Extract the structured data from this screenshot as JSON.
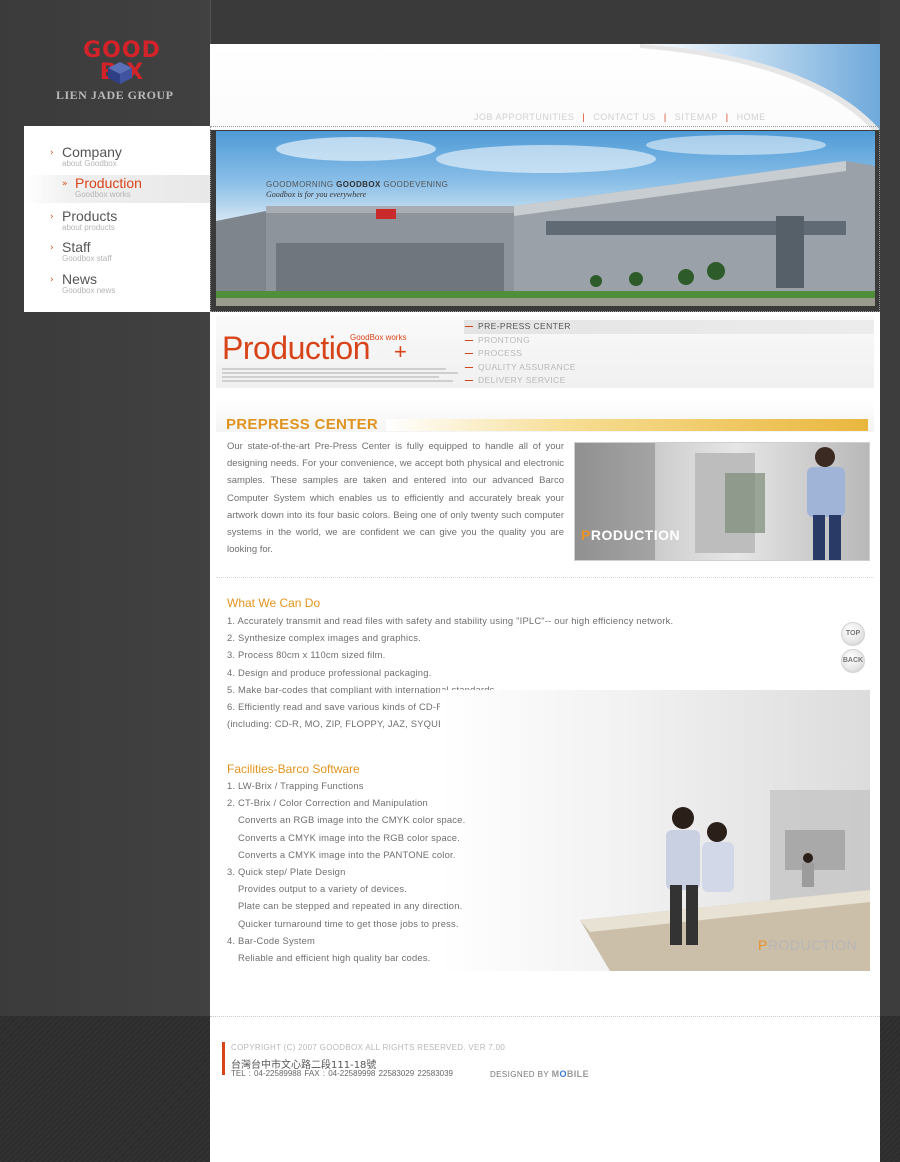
{
  "logo": {
    "word_top": "GOOD",
    "word_bottom": "B  X",
    "group_name": "LIEN JADE GROUP",
    "accent": "#d3232a"
  },
  "nav": {
    "items": [
      {
        "title": "Company",
        "subtitle": "about Goodbox",
        "active": false
      },
      {
        "title": "Production",
        "subtitle": "Goodbox works",
        "active": true
      },
      {
        "title": "Products",
        "subtitle": "about products",
        "active": false
      },
      {
        "title": "Staff",
        "subtitle": "Goodbox staff",
        "active": false
      },
      {
        "title": "News",
        "subtitle": "Goodbox news",
        "active": false
      }
    ],
    "arrow_color": "#d84a1b"
  },
  "top_links": [
    "JOB APPORTUNITIES",
    "CONTACT US",
    "SITEMAP",
    "HOME"
  ],
  "hero": {
    "slogan_pre": "GOODMORNING ",
    "slogan_bold": "GOODBOX",
    "slogan_post": " GOODEVENING",
    "slogan_sub": "Goodbox is for you everywhere"
  },
  "section": {
    "title": "Production",
    "plus": "+",
    "works": "GoodBox works",
    "accent": "#d8441a"
  },
  "subnav": [
    {
      "label": "PRE-PRESS CENTER",
      "active": true
    },
    {
      "label": "PRONTONG",
      "active": false
    },
    {
      "label": "PROCESS",
      "active": false
    },
    {
      "label": "QUALITY ASSURANCE",
      "active": false
    },
    {
      "label": "DELIVERY SERVICE",
      "active": false
    }
  ],
  "prepress": {
    "title": "PREPRESS CENTER",
    "body": "Our state-of-the-art Pre-Press Center is fully equipped to handle all of your designing needs. For your convenience, we accept both physical and electronic samples. These samples are taken and entered into our advanced Barco Computer System which enables us to efficiently and accurately break your artwork down into its four basic colors. Being one of only twenty such computer systems in the world, we are confident we can give you the quality you are looking for.",
    "photo_label_first": "P",
    "photo_label_rest": "RODUCTION"
  },
  "what_we_can_do": {
    "heading": "What We Can Do",
    "items": [
      "1. Accurately transmit and read files with safety and stability using \"IPLC\"-- our high efficiency network.",
      "2. Synthesize complex images and graphics.",
      "3. Process 80cm x 110cm sized film.",
      "4. Design and produce professional packaging.",
      "5. Make bar-codes that compliant with international standards.",
      "6. Efficiently read and save various kinds of CD-ROM files.",
      "(including: CD-R, MO, ZIP, FLOPPY, JAZ, SYQUEST)"
    ]
  },
  "buttons": {
    "top": "TOP",
    "back": "BACK"
  },
  "facilities": {
    "heading": "Facilities-Barco Software",
    "items": [
      {
        "text": "1. LW-Brix / Trapping Functions",
        "indent": false
      },
      {
        "text": "2. CT-Brix / Color Correction and Manipulation",
        "indent": false
      },
      {
        "text": "Converts an RGB image into the CMYK color space.",
        "indent": true
      },
      {
        "text": "Converts a CMYK image into the RGB color space.",
        "indent": true
      },
      {
        "text": "Converts a CMYK image into the PANTONE color.",
        "indent": true
      },
      {
        "text": "3. Quick step/ Plate Design",
        "indent": false
      },
      {
        "text": "Provides output to a variety of devices.",
        "indent": true
      },
      {
        "text": "Plate can be stepped and repeated in any direction.",
        "indent": true
      },
      {
        "text": "Quicker turnaround time to get those jobs to press.",
        "indent": true
      },
      {
        "text": "4. Bar-Code System",
        "indent": false
      },
      {
        "text": "Reliable and efficient high quality bar codes.",
        "indent": true
      }
    ],
    "photo_label_first": "P",
    "photo_label_rest": "RODUCTION"
  },
  "footer": {
    "copyright": "COPYRIGHT (C) 2007 GOODBOX ALL RIGHTS RESERVED. VER 7.00",
    "address": "台灣台中市文心路二段111-18號",
    "tel": "TEL : 04-22589988      FAX : 04-22589998      22583029      22583039",
    "designed_by": "DESIGNED BY",
    "brand_pre": "M",
    "brand_o": "O",
    "brand_post": "BILE"
  },
  "colors": {
    "accent_orange": "#e0941f",
    "accent_red": "#d8441a",
    "background_dark": "#3a3a3a"
  }
}
